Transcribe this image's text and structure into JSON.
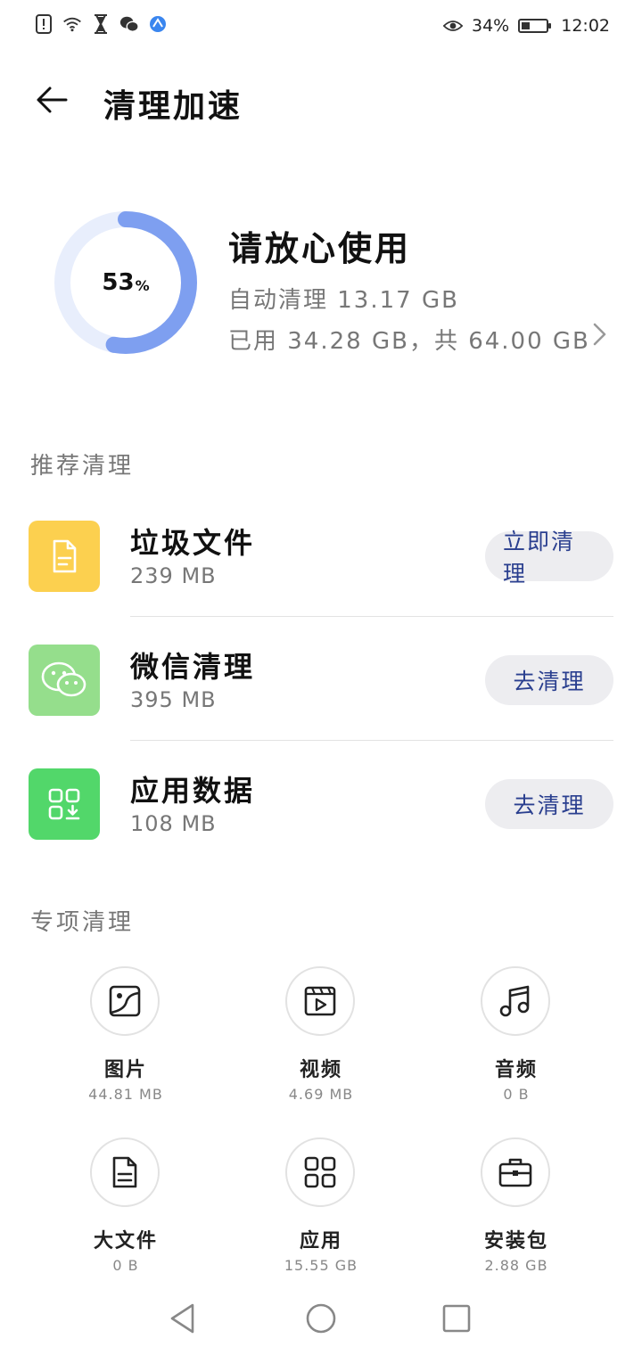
{
  "status_bar": {
    "left_icons": [
      "sim-alert-icon",
      "wifi-icon",
      "hourglass-icon",
      "wechat-icon",
      "browser-icon"
    ],
    "right": {
      "eye_icon": "eye-icon",
      "battery_percent": "34%",
      "battery_level": 0.34,
      "time": "12:02"
    }
  },
  "header": {
    "title": "清理加速",
    "back_icon": "arrow-left-icon"
  },
  "summary": {
    "percent": "53",
    "percent_symbol": "%",
    "percent_value": 53,
    "status": "请放心使用",
    "auto_clean": "自动清理 13.17 GB",
    "usage": "已用 34.28 GB，共 64.00 GB",
    "ring_color": "#7e9ff0",
    "ring_track_color": "#e8eefc"
  },
  "recommend": {
    "title": "推荐清理",
    "items": [
      {
        "name": "垃圾文件",
        "size": "239 MB",
        "button": "立即清理",
        "icon": "document-icon",
        "color": "#fcd04f"
      },
      {
        "name": "微信清理",
        "size": "395 MB",
        "button": "去清理",
        "icon": "wechat-icon",
        "color": "#95de8c"
      },
      {
        "name": "应用数据",
        "size": "108 MB",
        "button": "去清理",
        "icon": "app-data-icon",
        "color": "#52d76a"
      }
    ]
  },
  "special": {
    "title": "专项清理",
    "items": [
      {
        "label": "图片",
        "value": "44.81 MB",
        "icon": "image-icon"
      },
      {
        "label": "视频",
        "value": "4.69 MB",
        "icon": "video-icon"
      },
      {
        "label": "音频",
        "value": "0 B",
        "icon": "music-icon"
      },
      {
        "label": "大文件",
        "value": "0 B",
        "icon": "file-icon"
      },
      {
        "label": "应用",
        "value": "15.55 GB",
        "icon": "apps-grid-icon"
      },
      {
        "label": "安装包",
        "value": "2.88 GB",
        "icon": "briefcase-icon"
      }
    ]
  },
  "nav_bar": {
    "icons": [
      "nav-back-icon",
      "nav-home-icon",
      "nav-recents-icon"
    ]
  }
}
